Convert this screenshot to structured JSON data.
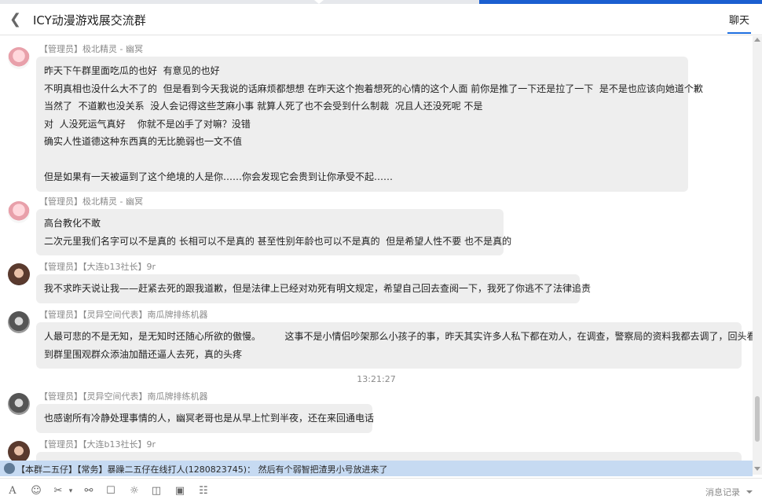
{
  "window": {
    "title": "ICY动漫游戏展交流群",
    "tab_chat": "聊天"
  },
  "messages": [
    {
      "sender": "【管理员】极北精灵 - 幽冥",
      "lines": [
        "昨天下午群里面吃瓜的也好  有意见的也好",
        "不明真相也没什么大不了的  但是看到今天我说的话麻烦都想想 在昨天这个抱着想死的心情的这个人面 前你是推了一下还是拉了一下  是不是也应该向她道个歉",
        "当然了  不道歉也没关系  没人会记得这些芝麻小事 就算人死了也不会受到什么制裁  况且人还没死呢 不是",
        "对  人没死运气真好    你就不是凶手了对嘛？没错",
        "确实人性道德这种东西真的无比脆弱也一文不值",
        "",
        "但是如果有一天被逼到了这个绝境的人是你……你会发现它会贵到让你承受不起……"
      ]
    },
    {
      "sender": "【管理员】极北精灵 - 幽冥",
      "lines": [
        "高台教化不敢",
        "二次元里我们名字可以不是真的 长相可以不是真的 甚至性别年龄也可以不是真的  但是希望人性不要 也不是真的"
      ]
    },
    {
      "sender": "【管理员】【大连b13社长】9r",
      "lines": [
        "我不求昨天说让我——赶紧去死的跟我道歉，但是法律上已经对劝死有明文规定，希望自己回去查阅一下，我死了你逃不了法律追责"
      ]
    },
    {
      "sender": "【管理员】【灵异空间代表】南瓜牌排练机器",
      "lines": [
        "人最可悲的不是无知，是无知时还随心所欲的傲慢。        这事不是小情侣吵架那么小孩子的事，昨天其实许多人私下都在劝人，在调查，警察局的资料我都去调了，回头看",
        "到群里围观群众添油加醋还逼人去死，真的头疼"
      ]
    },
    {
      "sender": "【管理员】【灵异空间代表】南瓜牌排练机器",
      "lines": [
        "也感谢所有冷静处理事情的人，幽冥老哥也是从早上忙到半夜，还在来回通电话"
      ]
    },
    {
      "sender": "【管理员】【大连b13社长】9r",
      "lines": [
        ""
      ]
    }
  ],
  "timestamp": "13:21:27",
  "notice": "【本群二五仔】【常务】暴躁二五仔在线打人(1280823745)： 然后有个弱智把渣男小号放进来了",
  "toolbar": {
    "history_label": "消息记录",
    "icons": [
      "font-icon",
      "emoji-icon",
      "scissors-icon",
      "microphone-icon",
      "sticker-icon",
      "shake-icon",
      "folder-icon",
      "image-icon",
      "gift-icon",
      "calendar-icon"
    ]
  }
}
